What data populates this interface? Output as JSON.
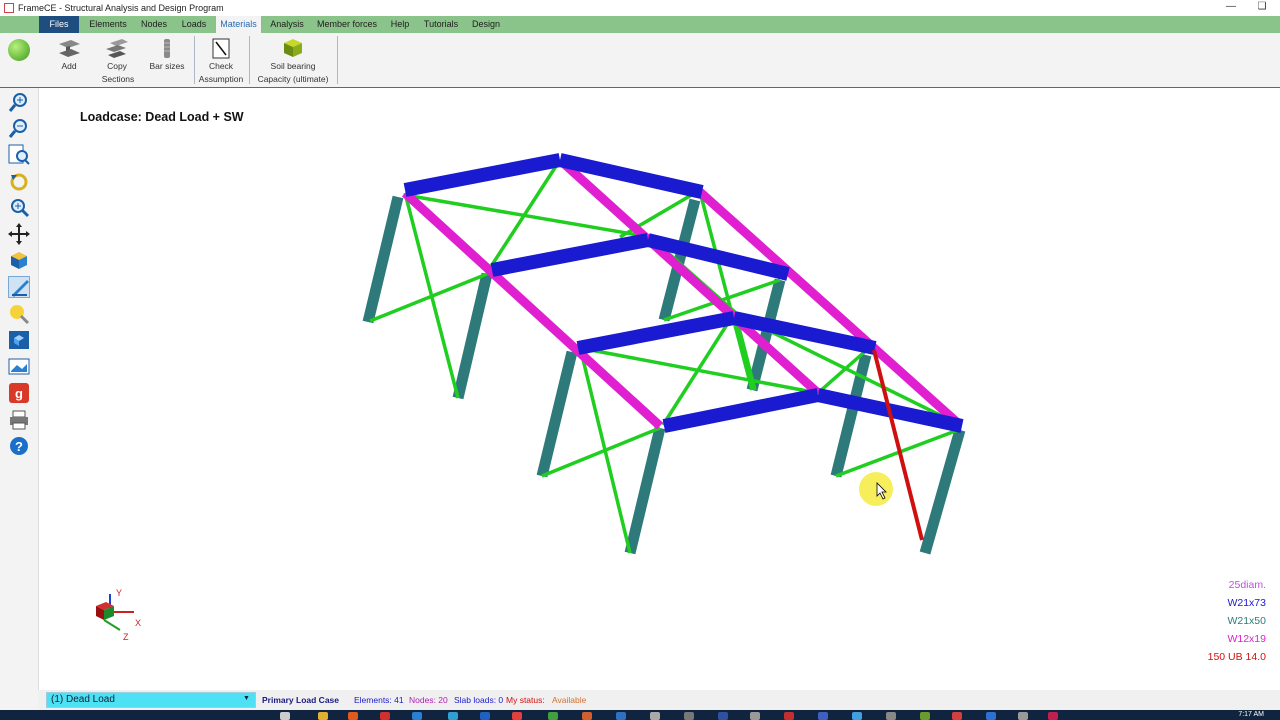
{
  "window": {
    "title": "FrameCE - Structural Analysis and Design Program"
  },
  "menu": {
    "tabs": [
      "Files",
      "Elements",
      "Nodes",
      "Loads",
      "Materials",
      "Analysis",
      "Member forces",
      "Help",
      "Tutorials",
      "Design"
    ],
    "active": "Materials"
  },
  "ribbon": {
    "add": "Add",
    "copy": "Copy",
    "bar_sizes": "Bar sizes",
    "sections_group": "Sections",
    "check": "Check",
    "assumption_group": "Assumption",
    "soil_bearing": "Soil bearing",
    "capacity_group": "Capacity (ultimate)"
  },
  "toolbar": {
    "icons": [
      "zoom-in-icon",
      "zoom-out-icon",
      "zoom-window-icon",
      "rotate-icon",
      "zoom-extents-icon",
      "pan-icon",
      "view-3d-icon",
      "draw-mode-icon",
      "light-icon",
      "box-view-icon",
      "screenshot-icon",
      "google-icon",
      "print-icon",
      "help-icon"
    ]
  },
  "viewport": {
    "loadcase_title": "Loadcase: Dead Load + SW",
    "axes": {
      "x": "X",
      "y": "Y",
      "z": "Z"
    }
  },
  "legend": [
    {
      "label": "25diam.",
      "color": "#c050d8"
    },
    {
      "label": "W21x73",
      "color": "#1a1ad0"
    },
    {
      "label": "W21x50",
      "color": "#2e7a7a"
    },
    {
      "label": "W12x19",
      "color": "#e020d0"
    },
    {
      "label": "150 UB 14.0",
      "color": "#d01010"
    }
  ],
  "status": {
    "load_case": "(1) Dead Load",
    "primary": "Primary Load Case",
    "elements": "Elements: 41",
    "nodes": "Nodes: 20",
    "slab_loads": "Slab loads: 0",
    "my_status_label": "My status:",
    "my_status_value": "Available"
  },
  "taskbar": {
    "time": "7:17 AM"
  }
}
